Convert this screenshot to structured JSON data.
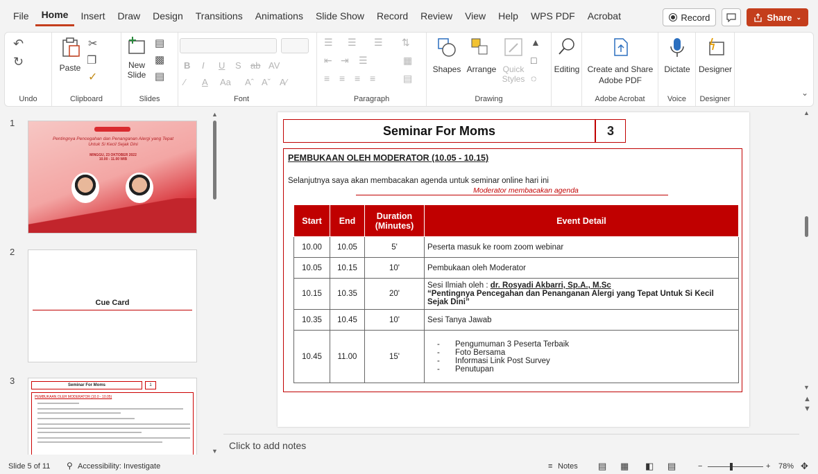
{
  "menu": {
    "tabs": [
      "File",
      "Home",
      "Insert",
      "Draw",
      "Design",
      "Transitions",
      "Animations",
      "Slide Show",
      "Record",
      "Review",
      "View",
      "Help",
      "WPS PDF",
      "Acrobat"
    ],
    "active_tab": "Home",
    "record_label": "Record",
    "share_label": "Share"
  },
  "ribbon": {
    "groups": {
      "undo": "Undo",
      "clipboard": "Clipboard",
      "slides": "Slides",
      "font": "Font",
      "paragraph": "Paragraph",
      "drawing": "Drawing",
      "adobe": "Adobe Acrobat",
      "voice": "Voice",
      "designer": "Designer"
    },
    "buttons": {
      "paste": "Paste",
      "new_slide_1": "New",
      "new_slide_2": "Slide",
      "shapes": "Shapes",
      "arrange": "Arrange",
      "quick_styles_1": "Quick",
      "quick_styles_2": "Styles",
      "editing": "Editing",
      "create_share_1": "Create and Share",
      "create_share_2": "Adobe PDF",
      "dictate": "Dictate",
      "designer": "Designer"
    }
  },
  "thumbnails": [
    {
      "num": "1",
      "title": "Pentingnya Pencegahan dan Penanganan Alergi yang Tepat Untuk Si Kecil Sejak Dini",
      "date": "MINGGU, 23 OKTOBER 2022",
      "time": "10.00 - 11.00 WIB"
    },
    {
      "num": "2",
      "text": "Cue Card"
    },
    {
      "num": "3",
      "title": "Seminar For Moms",
      "badge": "1",
      "sub": "PEMBUKAAN OLEH MODERATOR (10.0 - 10.05)"
    }
  ],
  "slide": {
    "title": "Seminar For Moms",
    "number": "3",
    "heading": "PEMBUKAAN OLEH MODERATOR (10.05 - 10.15)",
    "intro": "Selanjutnya saya akan membacakan agenda untuk seminar online hari ini",
    "note": "Moderator membacakan agenda",
    "table": {
      "headers": [
        "Start",
        "End",
        "Duration (Minutes)",
        "Event Detail"
      ],
      "rows": [
        {
          "start": "10.00",
          "end": "10.05",
          "duration": "5'",
          "detail": "Peserta masuk ke room zoom webinar"
        },
        {
          "start": "10.05",
          "end": "10.15",
          "duration": "10'",
          "detail": "Pembukaan oleh Moderator"
        },
        {
          "start": "10.15",
          "end": "10.35",
          "duration": "20'",
          "detail_a": "Sesi Ilmiah oleh : ",
          "detail_b": "dr. Rosyadi Akbarri, Sp.A., M.Sc",
          "detail_c": "“Pentingnya Pencegahan dan Penanganan Alergi yang Tepat Untuk Si Kecil Sejak Dini”"
        },
        {
          "start": "10.35",
          "end": "10.45",
          "duration": "10'",
          "detail": "Sesi Tanya Jawab"
        },
        {
          "start": "10.45",
          "end": "11.00",
          "duration": "15'",
          "items": [
            "Pengumuman 3 Peserta Terbaik",
            "Foto Bersama",
            "Informasi Link Post Survey",
            "Penutupan"
          ]
        }
      ]
    }
  },
  "notes_placeholder": "Click to add notes",
  "status": {
    "slide_info": "Slide 5 of 11",
    "accessibility": "Accessibility: Investigate",
    "notes": "Notes",
    "zoom": "78%"
  },
  "colors": {
    "accent": "#c43e1c",
    "table_header": "#c00000",
    "border_red": "#c00000"
  }
}
